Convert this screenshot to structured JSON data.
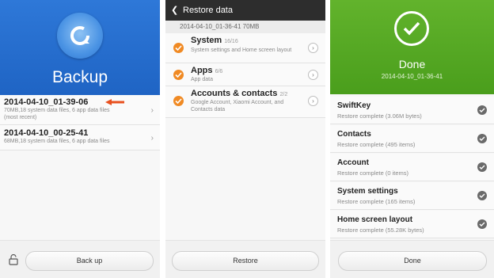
{
  "panel1": {
    "title": "Backup",
    "backups": [
      {
        "name": "2014-04-10_01-39-06",
        "detail": "70MB,18  system data files, 6  app data files",
        "note": "(most recent)"
      },
      {
        "name": "2014-04-10_00-25-41",
        "detail": "68MB,18  system data files, 6  app data files",
        "note": ""
      }
    ],
    "backup_button": "Back up"
  },
  "panel2": {
    "title": "Restore data",
    "subtitle": "2014-04-10_01-36-41   70MB",
    "items": [
      {
        "label": "System",
        "count": "16/16",
        "desc": "System settings and Home screen layout"
      },
      {
        "label": "Apps",
        "count": "6/6",
        "desc": "App data"
      },
      {
        "label": "Accounts & contacts",
        "count": "2/2",
        "desc": "Google Account, Xiaomi Account, and Contacts data"
      }
    ],
    "restore_button": "Restore"
  },
  "panel3": {
    "title": "Done",
    "date": "2014-04-10_01-36-41",
    "items": [
      {
        "label": "SwiftKey",
        "status": "Restore complete (3.06M  bytes)"
      },
      {
        "label": "Contacts",
        "status": "Restore complete (495  items)"
      },
      {
        "label": "Account",
        "status": "Restore complete (0  items)"
      },
      {
        "label": "System settings",
        "status": "Restore complete (165  items)"
      },
      {
        "label": "Home screen layout",
        "status": "Restore complete (55.28K  bytes)"
      }
    ],
    "done_button": "Done"
  },
  "colors": {
    "backup_blue": "#2e78d8",
    "done_green": "#58a924",
    "orange": "#f08a24",
    "dark_header": "#2d2d2d"
  },
  "icons": {
    "backup_logo": "circular-arrow-icon",
    "annotation": "arrow-left-icon",
    "lock": "unlock-icon",
    "done": "checkmark-icon"
  }
}
